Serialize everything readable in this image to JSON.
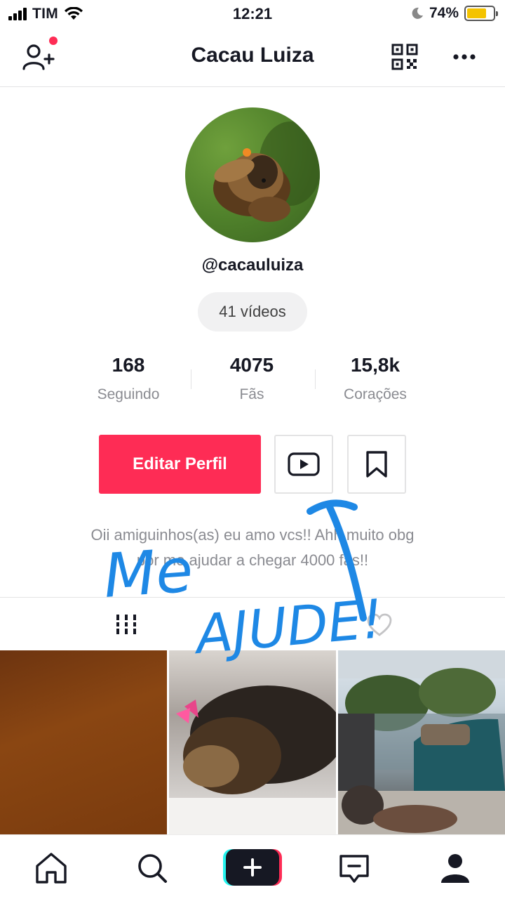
{
  "status_bar": {
    "carrier": "TIM",
    "time": "12:21",
    "battery": "74%",
    "battery_level": 0.74
  },
  "header": {
    "title": "Cacau Luiza",
    "icons": [
      "add-user-icon",
      "qr-code-icon",
      "more-icon"
    ]
  },
  "profile": {
    "username": "@cacauluiza",
    "videos_label": "41 vídeos",
    "stats": [
      {
        "value": "168",
        "label": "Seguindo"
      },
      {
        "value": "4075",
        "label": "Fãs"
      },
      {
        "value": "15,8k",
        "label": "Corações"
      }
    ],
    "edit_button": "Editar Perfil",
    "bio_line1": "Oii amiguinhos(as) eu amo vcs!! Ahh muito obg",
    "bio_line2": "por me ajudar a chegar 4000 fãs!!"
  },
  "tabs": [
    "grid-icon",
    "heart-icon"
  ],
  "bottom_nav": [
    "home-icon",
    "discover-icon",
    "create-icon",
    "inbox-icon",
    "profile-icon"
  ],
  "handwriting": {
    "line1": "Me",
    "line2": "AJUDE!"
  },
  "colors": {
    "accent": "#fe2c55",
    "annotation": "#1e88e5"
  }
}
